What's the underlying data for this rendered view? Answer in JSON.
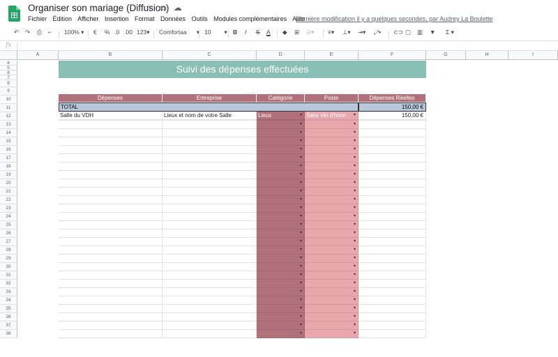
{
  "app": {
    "title": "Organiser son mariage (Diffusion)",
    "menu": [
      "Fichier",
      "Édition",
      "Afficher",
      "Insertion",
      "Format",
      "Données",
      "Outils",
      "Modules complémentaires",
      "Aide"
    ],
    "last_edit": "Dernière modification il y a quelques secondes, par Audrey La Boulette"
  },
  "toolbar": {
    "zoom": "100%",
    "currency": "€",
    "percent": "%",
    "dec_less": ".0",
    "dec_more": ".00",
    "format_more": "123",
    "font": "Comfortaa",
    "font_size": "10",
    "bold": "B",
    "italic": "I",
    "strike": "S",
    "text_color": "A",
    "sum": "Σ"
  },
  "formula_bar": {
    "fx": "fx",
    "value": ""
  },
  "columns": [
    "A",
    "B",
    "C",
    "D",
    "E",
    "F",
    "G",
    "H",
    "I"
  ],
  "rows": [
    "4",
    "5",
    "6",
    "7",
    "8",
    "9",
    "10",
    "11",
    "12",
    "13",
    "14",
    "15",
    "16",
    "17",
    "18",
    "19",
    "20",
    "21",
    "22",
    "23",
    "24",
    "25",
    "26",
    "27",
    "28",
    "29",
    "30",
    "31",
    "32",
    "33",
    "34",
    "35",
    "36",
    "37",
    "38"
  ],
  "sheet": {
    "banner": "Suivi des dépenses effectuées",
    "headers": [
      "Dépenses",
      "Entreprise",
      "Catégorie",
      "Poste",
      "Dépenses Réelles"
    ],
    "total": {
      "label": "TOTAL",
      "value": "150,00 €"
    },
    "entries": [
      {
        "depense": "Salle du VDH",
        "entreprise": "Lieux et nom de votre Salle",
        "categorie": "Lieux",
        "poste": "Salle Vin d'honn",
        "montant": "150,00 €"
      }
    ]
  },
  "colors": {
    "banner": "#89bfb4",
    "header": "#b1717a",
    "total": "#b8c7dc",
    "categorie": "#b1717a",
    "poste": "#e8a6ad",
    "logo": "#23a566"
  },
  "icons": [
    "undo-icon",
    "redo-icon",
    "print-icon",
    "paint-format-icon",
    "star-icon",
    "folder-icon",
    "cloud-icon",
    "fill-color-icon",
    "borders-icon",
    "merge-icon",
    "align-icon",
    "valign-icon",
    "wrap-icon",
    "rotate-icon",
    "link-icon",
    "comment-icon",
    "chart-icon",
    "filter-icon"
  ]
}
